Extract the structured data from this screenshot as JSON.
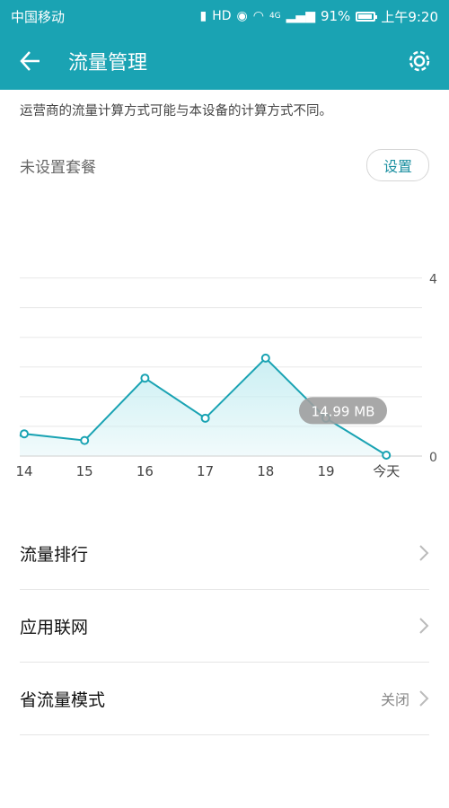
{
  "status_bar": {
    "carrier": "中国移动",
    "network": "4G",
    "battery": "91%",
    "time": "上午9:20",
    "battery_level": 0.91
  },
  "app_bar": {
    "title": "流量管理",
    "back_icon": "arrow-left-icon",
    "settings_icon": "gear-icon"
  },
  "notice": "运营商的流量计算方式可能与本设备的计算方式不同。",
  "plan": {
    "label": "未设置套餐",
    "button": "设置"
  },
  "chart_data": {
    "type": "area",
    "categories": [
      "14",
      "15",
      "16",
      "17",
      "18",
      "19",
      "今天"
    ],
    "x_positions_hint": [
      13.5,
      14.5,
      15.5,
      16.5,
      17.5,
      18.5,
      19.5
    ],
    "values": [
      0.5,
      0.35,
      1.75,
      0.85,
      2.2,
      0.85,
      0.02
    ],
    "ylim": [
      0,
      5
    ],
    "y_ticks": [
      0,
      4
    ],
    "grid": true,
    "tooltip": "14.99 MB",
    "line_color": "#1aa3b3",
    "fill_color": "#c8eef2"
  },
  "list": [
    {
      "label": "流量排行",
      "value": ""
    },
    {
      "label": "应用联网",
      "value": ""
    },
    {
      "label": "省流量模式",
      "value": "关闭"
    },
    {
      "label": "",
      "value": ""
    }
  ],
  "colors": {
    "primary": "#1aa3b3",
    "link": "#1a8fa0"
  }
}
